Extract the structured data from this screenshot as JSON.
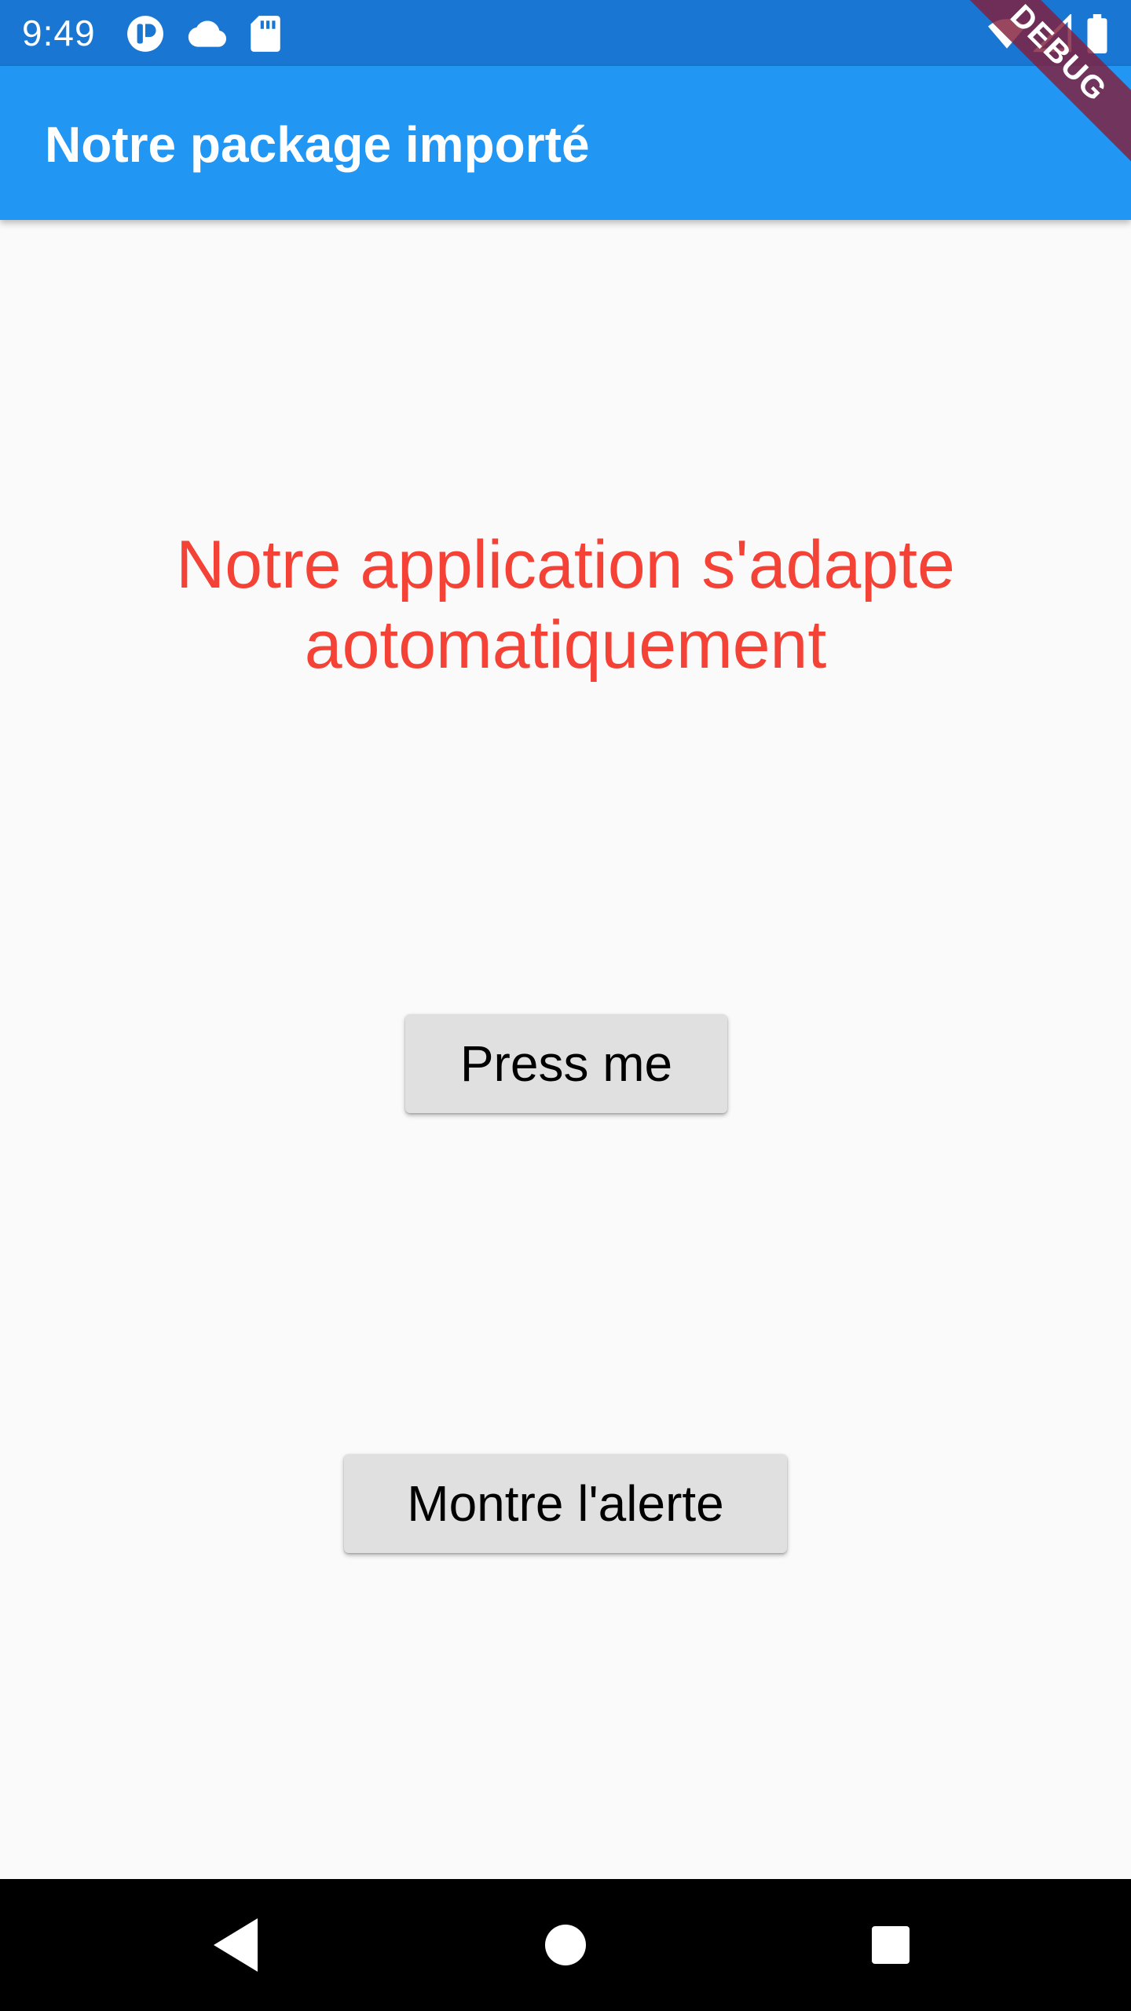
{
  "status_bar": {
    "time": "9:49",
    "left_icons": [
      "app-notification-icon",
      "cloud-icon",
      "sd-card-icon"
    ],
    "right_icons": [
      "wifi-icon",
      "cell-signal-icon",
      "battery-icon"
    ],
    "background": "#1976d2"
  },
  "debug_banner": {
    "label": "DEBUG"
  },
  "app_bar": {
    "title": "Notre package importé",
    "background": "#2196f3"
  },
  "main": {
    "message_line1": "Notre application s'adapte",
    "message_line2": "aotomatiquement",
    "message_color": "#f44336",
    "press_button_label": "Press me",
    "alert_button_label": "Montre l'alerte"
  },
  "nav_bar": {
    "buttons": [
      "back-icon",
      "home-icon",
      "recents-icon"
    ]
  }
}
